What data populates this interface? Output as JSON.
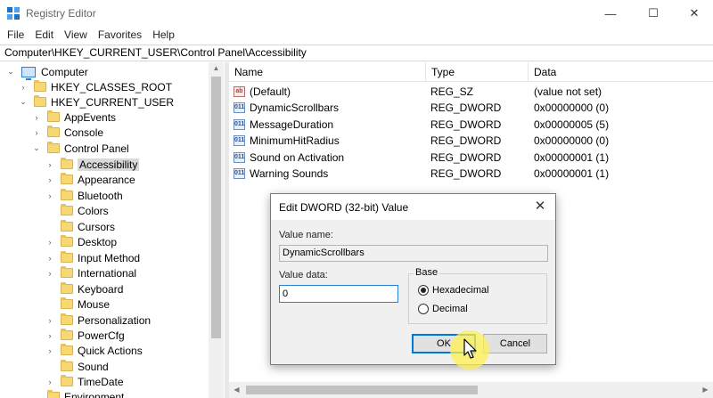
{
  "window": {
    "title": "Registry Editor",
    "minimize_glyph": "—",
    "maximize_glyph": "☐",
    "close_glyph": "✕",
    "icon": "registry-editor-icon"
  },
  "menu": [
    "File",
    "Edit",
    "View",
    "Favorites",
    "Help"
  ],
  "address": "Computer\\HKEY_CURRENT_USER\\Control Panel\\Accessibility",
  "tree": [
    {
      "label": "Computer",
      "chev": "⌄",
      "icon": "computer-icon"
    },
    {
      "label": "HKEY_CLASSES_ROOT",
      "chev": "›",
      "icon": "folder-icon"
    },
    {
      "label": "HKEY_CURRENT_USER",
      "chev": "⌄",
      "icon": "folder-icon"
    },
    {
      "label": "AppEvents",
      "chev": "›",
      "icon": "folder-icon"
    },
    {
      "label": "Console",
      "chev": "›",
      "icon": "folder-icon"
    },
    {
      "label": "Control Panel",
      "chev": "⌄",
      "icon": "folder-icon"
    },
    {
      "label": "Accessibility",
      "chev": "›",
      "icon": "folder-icon",
      "selected": true
    },
    {
      "label": "Appearance",
      "chev": "›",
      "icon": "folder-icon"
    },
    {
      "label": "Bluetooth",
      "chev": "›",
      "icon": "folder-icon"
    },
    {
      "label": "Colors",
      "chev": "",
      "icon": "folder-icon"
    },
    {
      "label": "Cursors",
      "chev": "",
      "icon": "folder-icon"
    },
    {
      "label": "Desktop",
      "chev": "›",
      "icon": "folder-icon"
    },
    {
      "label": "Input Method",
      "chev": "›",
      "icon": "folder-icon"
    },
    {
      "label": "International",
      "chev": "›",
      "icon": "folder-icon"
    },
    {
      "label": "Keyboard",
      "chev": "",
      "icon": "folder-icon"
    },
    {
      "label": "Mouse",
      "chev": "",
      "icon": "folder-icon"
    },
    {
      "label": "Personalization",
      "chev": "›",
      "icon": "folder-icon"
    },
    {
      "label": "PowerCfg",
      "chev": "›",
      "icon": "folder-icon"
    },
    {
      "label": "Quick Actions",
      "chev": "›",
      "icon": "folder-icon"
    },
    {
      "label": "Sound",
      "chev": "",
      "icon": "folder-icon"
    },
    {
      "label": "TimeDate",
      "chev": "›",
      "icon": "folder-icon"
    },
    {
      "label": "Environment",
      "chev": "",
      "icon": "folder-icon"
    }
  ],
  "list": {
    "headers": [
      "Name",
      "Type",
      "Data"
    ],
    "rows": [
      {
        "icon": "ab",
        "name": "(Default)",
        "type": "REG_SZ",
        "data": "(value not set)"
      },
      {
        "icon": "011",
        "name": "DynamicScrollbars",
        "type": "REG_DWORD",
        "data": "0x00000000 (0)"
      },
      {
        "icon": "011",
        "name": "MessageDuration",
        "type": "REG_DWORD",
        "data": "0x00000005 (5)"
      },
      {
        "icon": "011",
        "name": "MinimumHitRadius",
        "type": "REG_DWORD",
        "data": "0x00000000 (0)"
      },
      {
        "icon": "011",
        "name": "Sound on Activation",
        "type": "REG_DWORD",
        "data": "0x00000001 (1)"
      },
      {
        "icon": "011",
        "name": "Warning Sounds",
        "type": "REG_DWORD",
        "data": "0x00000001 (1)"
      }
    ]
  },
  "dialog": {
    "title": "Edit DWORD (32-bit) Value",
    "close_glyph": "✕",
    "value_name_label": "Value name:",
    "value_name": "DynamicScrollbars",
    "value_data_label": "Value data:",
    "value_data": "0",
    "base_label": "Base",
    "base_options": [
      "Hexadecimal",
      "Decimal"
    ],
    "base_selected": "Hexadecimal",
    "ok_label": "OK",
    "cancel_label": "Cancel"
  },
  "colors": {
    "accent": "#0078d7",
    "folder": "#f8d775",
    "cursor_highlight": "#fff050"
  }
}
